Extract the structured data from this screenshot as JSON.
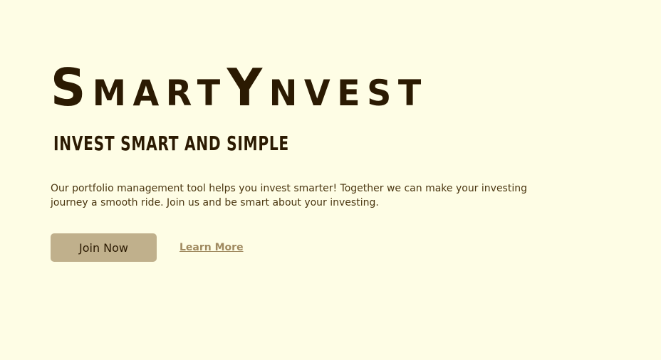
{
  "hero": {
    "brand_title": "SmartYnvest",
    "tagline": "Invest smart and simple",
    "description": "Our portfolio management tool helps you invest smarter! Together we can make your investing journey a smooth ride. Join us and be smart about your investing.",
    "primary_button_label": "Join Now",
    "secondary_link_label": "Learn More"
  },
  "colors": {
    "background": "#fefde5",
    "text_dark": "#2b1a02",
    "button_bg": "#c0b08c",
    "link": "#a08a60"
  }
}
